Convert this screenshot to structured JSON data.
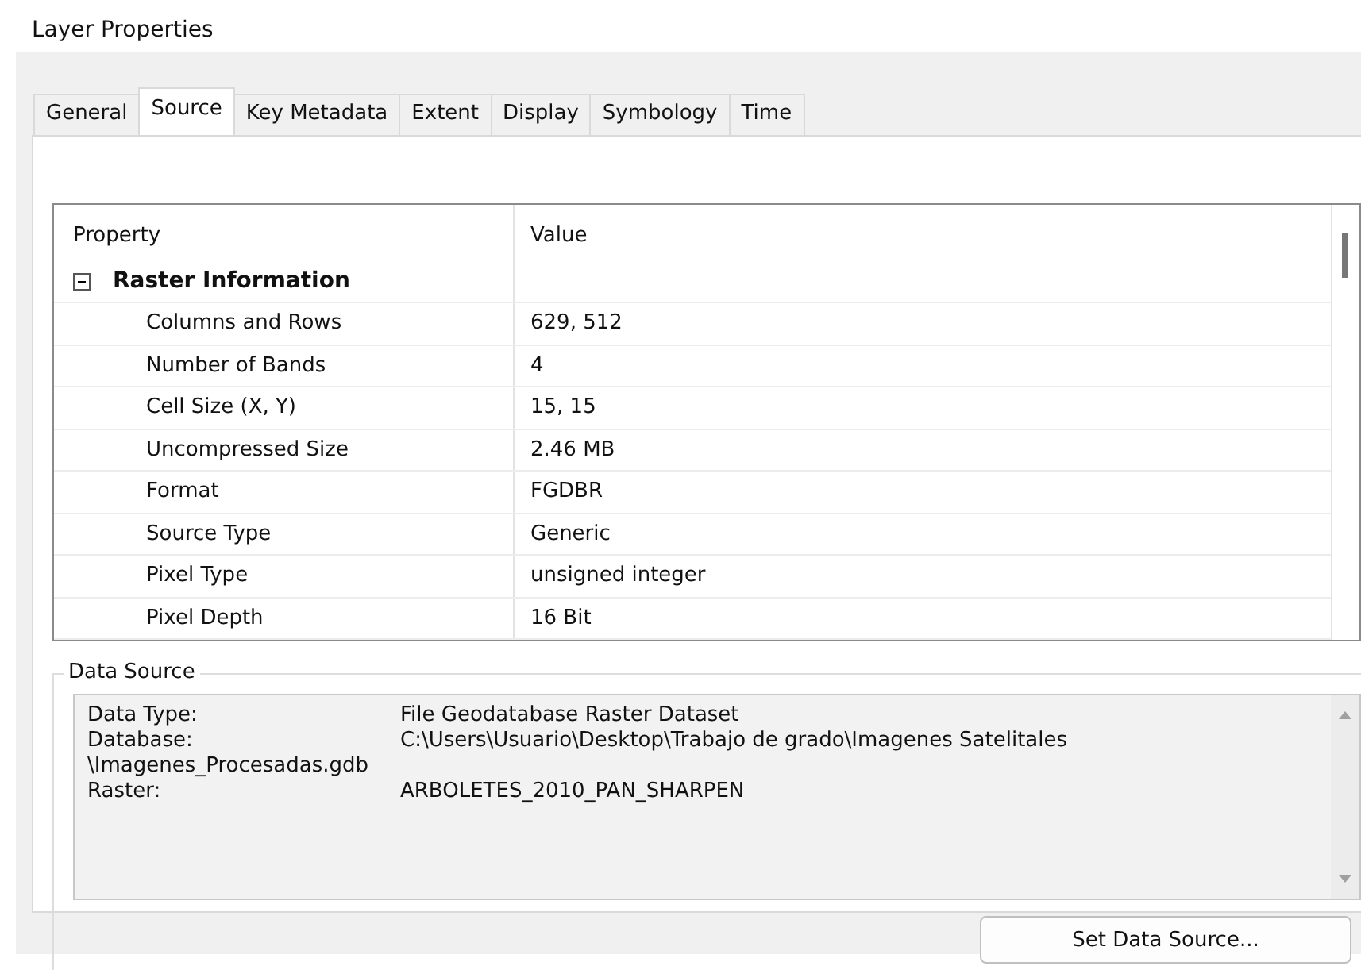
{
  "window": {
    "title": "Layer Properties"
  },
  "tabs": [
    {
      "label": "General",
      "selected": false
    },
    {
      "label": "Source",
      "selected": true
    },
    {
      "label": "Key Metadata",
      "selected": false
    },
    {
      "label": "Extent",
      "selected": false
    },
    {
      "label": "Display",
      "selected": false
    },
    {
      "label": "Symbology",
      "selected": false
    },
    {
      "label": "Time",
      "selected": false
    }
  ],
  "table": {
    "columns": [
      "Property",
      "Value"
    ],
    "groups": [
      {
        "label": "Raster Information",
        "expanded": true,
        "children": [
          {
            "property": "Columns and Rows",
            "value": "629, 512"
          },
          {
            "property": "Number of Bands",
            "value": "4"
          },
          {
            "property": "Cell Size (X, Y)",
            "value": "15, 15"
          },
          {
            "property": "Uncompressed Size",
            "value": "2.46 MB"
          },
          {
            "property": "Format",
            "value": "FGDBR"
          },
          {
            "property": "Source Type",
            "value": "Generic"
          },
          {
            "property": "Pixel Type",
            "value": "unsigned integer"
          },
          {
            "property": "Pixel Depth",
            "value": "16 Bit"
          }
        ]
      }
    ]
  },
  "data_source": {
    "title": "Data Source",
    "lines": [
      {
        "label": "Data Type:",
        "value": "File Geodatabase Raster Dataset"
      },
      {
        "label": "Database:",
        "value": "C:\\Users\\Usuario\\Desktop\\Trabajo de grado\\Imagenes Satelitales",
        "continuation": "\\Imagenes_Procesadas.gdb"
      },
      {
        "label": "Raster:",
        "value": "ARBOLETES_2010_PAN_SHARPEN"
      }
    ],
    "button": "Set Data Source..."
  }
}
